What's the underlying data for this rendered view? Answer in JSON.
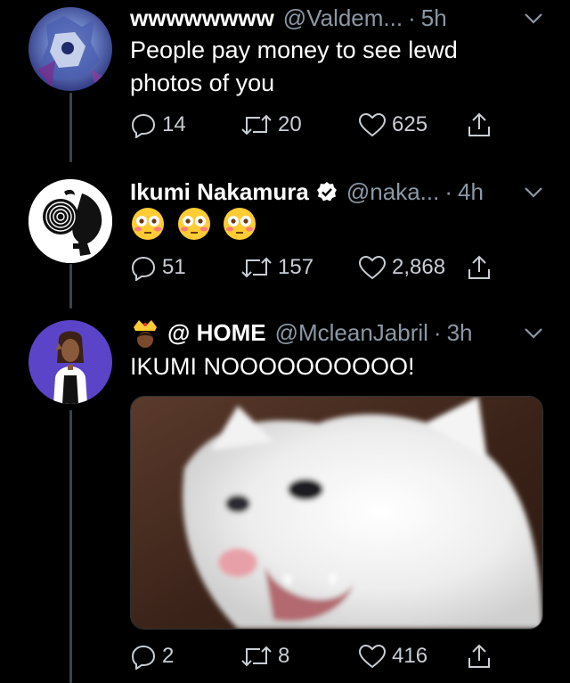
{
  "tweets": [
    {
      "name": "wwwwwwww",
      "handle": "@Valdem...",
      "dot": "·",
      "time": "5h",
      "text": "People pay money to see lewd photos of you",
      "replies": "14",
      "retweets": "20",
      "likes": "625"
    },
    {
      "name": "Ikumi Nakamura",
      "handle": "@naka...",
      "dot": "·",
      "time": "4h",
      "text": "😳😳😳",
      "replies": "51",
      "retweets": "157",
      "likes": "2,868"
    },
    {
      "name": "@ HOME",
      "handle": "@McleanJabril",
      "dot": "·",
      "time": "3h",
      "text": "IKUMI NOOOOOOOOOO!",
      "replies": "2",
      "retweets": "8",
      "likes": "416"
    }
  ],
  "icons": {
    "reply": "reply-icon",
    "retweet": "retweet-icon",
    "like": "heart-icon",
    "share": "share-icon",
    "more": "chevron-down-icon",
    "verified": "verified-badge-icon",
    "crown": "crown-emoji-icon",
    "flushed": "flushed-face-emoji-icon"
  },
  "colors": {
    "background": "#000000",
    "secondary_text": "#8b98a5",
    "thread_line": "#3d4249",
    "verified_badge": "#1da1f2"
  }
}
